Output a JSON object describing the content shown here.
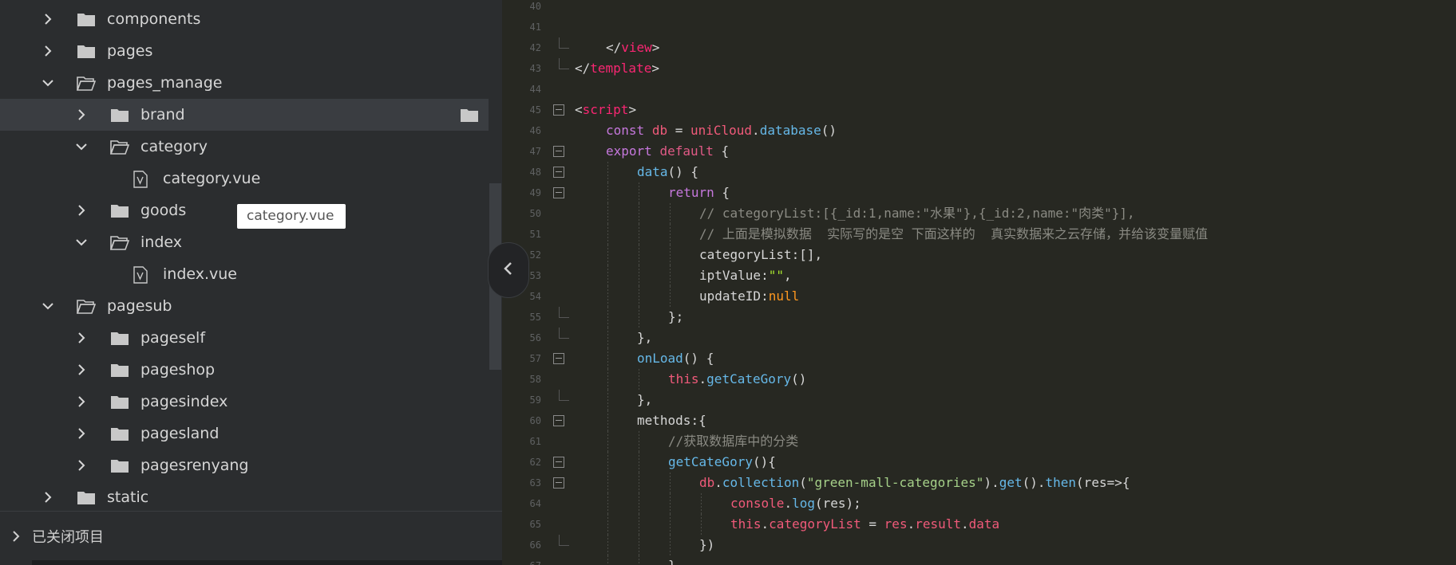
{
  "sidebar": {
    "tree": [
      {
        "label": "components",
        "level": 1,
        "expanded": false,
        "type": "folder"
      },
      {
        "label": "pages",
        "level": 1,
        "expanded": false,
        "type": "folder"
      },
      {
        "label": "pages_manage",
        "level": 1,
        "expanded": true,
        "type": "folder"
      },
      {
        "label": "brand",
        "level": 2,
        "expanded": false,
        "type": "folder",
        "selected": true
      },
      {
        "label": "category",
        "level": 2,
        "expanded": true,
        "type": "folder"
      },
      {
        "label": "category.vue",
        "level": 3,
        "type": "vue-file"
      },
      {
        "label": "goods",
        "level": 2,
        "expanded": false,
        "type": "folder"
      },
      {
        "label": "index",
        "level": 2,
        "expanded": true,
        "type": "folder"
      },
      {
        "label": "index.vue",
        "level": 3,
        "type": "vue-file"
      },
      {
        "label": "pagesub",
        "level": 1,
        "expanded": true,
        "type": "folder"
      },
      {
        "label": "pageself",
        "level": 2,
        "expanded": false,
        "type": "folder"
      },
      {
        "label": "pageshop",
        "level": 2,
        "expanded": false,
        "type": "folder"
      },
      {
        "label": "pagesindex",
        "level": 2,
        "expanded": false,
        "type": "folder"
      },
      {
        "label": "pagesland",
        "level": 2,
        "expanded": false,
        "type": "folder"
      },
      {
        "label": "pagesrenyang",
        "level": 2,
        "expanded": false,
        "type": "folder"
      },
      {
        "label": "static",
        "level": 1,
        "expanded": false,
        "type": "folder"
      }
    ],
    "tooltip": "category.vue",
    "closed_projects_label": "已关闭项目"
  },
  "editor": {
    "lines": [
      {
        "n": "40",
        "fold": "none",
        "indent": 1,
        "tokens": []
      },
      {
        "n": "41",
        "fold": "none",
        "indent": 1,
        "tokens": []
      },
      {
        "n": "42",
        "fold": "end",
        "indent": 1,
        "tokens": [
          {
            "t": "</",
            "c": "t-punc"
          },
          {
            "t": "view",
            "c": "t-tag"
          },
          {
            "t": ">",
            "c": "t-punc"
          }
        ]
      },
      {
        "n": "43",
        "fold": "end",
        "indent": 0,
        "tokens": [
          {
            "t": "</",
            "c": "t-punc"
          },
          {
            "t": "template",
            "c": "t-tag"
          },
          {
            "t": ">",
            "c": "t-punc"
          }
        ]
      },
      {
        "n": "44",
        "fold": "none",
        "indent": 0,
        "tokens": []
      },
      {
        "n": "45",
        "fold": "start",
        "indent": 0,
        "tokens": [
          {
            "t": "<",
            "c": "t-punc"
          },
          {
            "t": "script",
            "c": "t-tag"
          },
          {
            "t": ">",
            "c": "t-punc"
          }
        ]
      },
      {
        "n": "46",
        "fold": "none",
        "indent": 1,
        "tokens": [
          {
            "t": "const",
            "c": "t-purple"
          },
          {
            "t": " ",
            "c": "t-punc"
          },
          {
            "t": "db",
            "c": "t-this"
          },
          {
            "t": " = ",
            "c": "t-punc"
          },
          {
            "t": "uniCloud",
            "c": "t-this"
          },
          {
            "t": ".",
            "c": "t-punc"
          },
          {
            "t": "database",
            "c": "t-func"
          },
          {
            "t": "()",
            "c": "t-punc"
          }
        ]
      },
      {
        "n": "47",
        "fold": "start",
        "indent": 1,
        "tokens": [
          {
            "t": "export",
            "c": "t-purple"
          },
          {
            "t": " ",
            "c": "t-punc"
          },
          {
            "t": "default",
            "c": "t-kw"
          },
          {
            "t": " {",
            "c": "t-punc"
          }
        ]
      },
      {
        "n": "48",
        "fold": "start",
        "indent": 2,
        "tokens": [
          {
            "t": "data",
            "c": "t-func"
          },
          {
            "t": "() {",
            "c": "t-punc"
          }
        ]
      },
      {
        "n": "49",
        "fold": "start",
        "indent": 3,
        "tokens": [
          {
            "t": "return",
            "c": "t-purple"
          },
          {
            "t": " {",
            "c": "t-punc"
          }
        ]
      },
      {
        "n": "50",
        "fold": "none",
        "indent": 4,
        "tokens": [
          {
            "t": "// categoryList:[{_id:1,name:\"水果\"},{_id:2,name:\"肉类\"}],",
            "c": "t-comment"
          }
        ]
      },
      {
        "n": "51",
        "fold": "none",
        "indent": 4,
        "tokens": [
          {
            "t": "// 上面是模拟数据  实际写的是空 下面这样的  真实数据来之云存储，并给该变量赋值",
            "c": "t-comment"
          }
        ]
      },
      {
        "n": "52",
        "fold": "none",
        "indent": 4,
        "tokens": [
          {
            "t": "categoryList",
            "c": "t-punc"
          },
          {
            "t": ":[],",
            "c": "t-punc"
          }
        ]
      },
      {
        "n": "53",
        "fold": "none",
        "indent": 4,
        "tokens": [
          {
            "t": "iptValue",
            "c": "t-punc"
          },
          {
            "t": ":",
            "c": "t-punc"
          },
          {
            "t": "\"\"",
            "c": "t-str"
          },
          {
            "t": ",",
            "c": "t-punc"
          }
        ]
      },
      {
        "n": "54",
        "fold": "none",
        "indent": 4,
        "tokens": [
          {
            "t": "updateID",
            "c": "t-punc"
          },
          {
            "t": ":",
            "c": "t-punc"
          },
          {
            "t": "null",
            "c": "t-null"
          }
        ]
      },
      {
        "n": "55",
        "fold": "end",
        "indent": 3,
        "tokens": [
          {
            "t": "};",
            "c": "t-punc"
          }
        ]
      },
      {
        "n": "56",
        "fold": "end",
        "indent": 2,
        "tokens": [
          {
            "t": "},",
            "c": "t-punc"
          }
        ]
      },
      {
        "n": "57",
        "fold": "start",
        "indent": 2,
        "tokens": [
          {
            "t": "onLoad",
            "c": "t-func"
          },
          {
            "t": "() {",
            "c": "t-punc"
          }
        ]
      },
      {
        "n": "58",
        "fold": "none",
        "indent": 3,
        "tokens": [
          {
            "t": "this",
            "c": "t-this"
          },
          {
            "t": ".",
            "c": "t-punc"
          },
          {
            "t": "getCateGory",
            "c": "t-func"
          },
          {
            "t": "()",
            "c": "t-punc"
          }
        ]
      },
      {
        "n": "59",
        "fold": "end",
        "indent": 2,
        "tokens": [
          {
            "t": "},",
            "c": "t-punc"
          }
        ]
      },
      {
        "n": "60",
        "fold": "start",
        "indent": 2,
        "tokens": [
          {
            "t": "methods",
            "c": "t-punc"
          },
          {
            "t": ":{",
            "c": "t-punc"
          }
        ]
      },
      {
        "n": "61",
        "fold": "none",
        "indent": 3,
        "tokens": [
          {
            "t": "//获取数据库中的分类",
            "c": "t-comment"
          }
        ]
      },
      {
        "n": "62",
        "fold": "start",
        "indent": 3,
        "tokens": [
          {
            "t": "getCateGory",
            "c": "t-func"
          },
          {
            "t": "(){",
            "c": "t-punc"
          }
        ]
      },
      {
        "n": "63",
        "fold": "start",
        "indent": 4,
        "tokens": [
          {
            "t": "db",
            "c": "t-this"
          },
          {
            "t": ".",
            "c": "t-punc"
          },
          {
            "t": "collection",
            "c": "t-func"
          },
          {
            "t": "(",
            "c": "t-punc"
          },
          {
            "t": "\"green-mall-categories\"",
            "c": "t-str2"
          },
          {
            "t": ").",
            "c": "t-punc"
          },
          {
            "t": "get",
            "c": "t-func"
          },
          {
            "t": "().",
            "c": "t-punc"
          },
          {
            "t": "then",
            "c": "t-func"
          },
          {
            "t": "(res=>{",
            "c": "t-punc"
          }
        ]
      },
      {
        "n": "64",
        "fold": "none",
        "indent": 5,
        "tokens": [
          {
            "t": "console",
            "c": "t-this"
          },
          {
            "t": ".",
            "c": "t-punc"
          },
          {
            "t": "log",
            "c": "t-func"
          },
          {
            "t": "(res);",
            "c": "t-punc"
          }
        ]
      },
      {
        "n": "65",
        "fold": "none",
        "indent": 5,
        "tokens": [
          {
            "t": "this",
            "c": "t-this"
          },
          {
            "t": ".",
            "c": "t-punc"
          },
          {
            "t": "categoryList",
            "c": "t-this"
          },
          {
            "t": " = ",
            "c": "t-punc"
          },
          {
            "t": "res",
            "c": "t-this"
          },
          {
            "t": ".",
            "c": "t-punc"
          },
          {
            "t": "result",
            "c": "t-this"
          },
          {
            "t": ".",
            "c": "t-punc"
          },
          {
            "t": "data",
            "c": "t-this"
          }
        ]
      },
      {
        "n": "66",
        "fold": "end",
        "indent": 4,
        "tokens": [
          {
            "t": "})",
            "c": "t-punc"
          }
        ]
      },
      {
        "n": "67",
        "fold": "none",
        "indent": 3,
        "tokens": [
          {
            "t": "}",
            "c": "t-punc"
          }
        ]
      }
    ]
  }
}
